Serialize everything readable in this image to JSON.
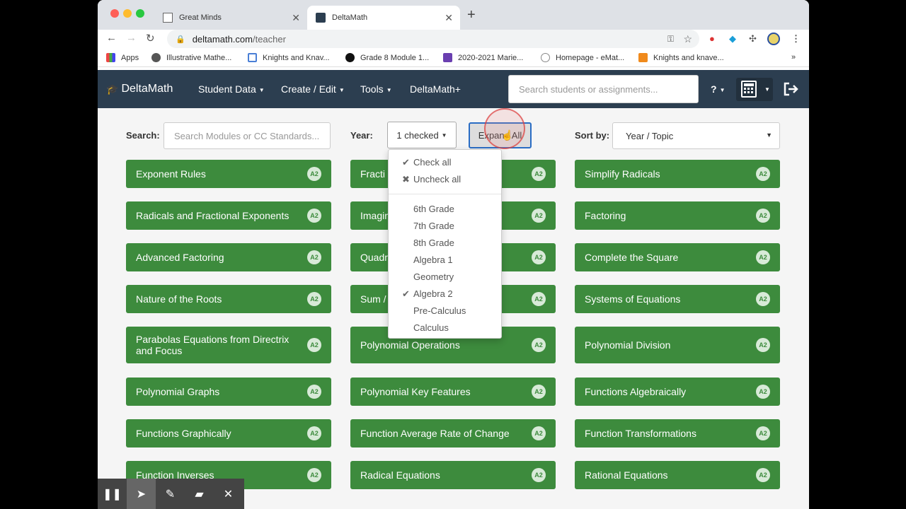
{
  "browser": {
    "tabs": [
      {
        "title": "Great Minds"
      },
      {
        "title": "DeltaMath"
      }
    ],
    "url_domain": "deltamath.com",
    "url_path": "/teacher",
    "bookmarks": [
      "Apps",
      "Illustrative Mathe...",
      "Knights and Knav...",
      "Grade 8 Module 1...",
      "2020-2021 Marie...",
      "Homepage - eMat...",
      "Knights and knave..."
    ],
    "bookmarks_more": "»"
  },
  "navbar": {
    "brand": "DeltaMath",
    "items": [
      "Student Data",
      "Create / Edit",
      "Tools",
      "DeltaMath+"
    ],
    "search_placeholder": "Search students or assignments...",
    "help": "?"
  },
  "filters": {
    "search_label": "Search:",
    "search_placeholder": "Search Modules or CC Standards...",
    "year_label": "Year:",
    "year_button": "1 checked",
    "expand_label": "Expand All",
    "sort_label": "Sort by:",
    "sort_value": "Year / Topic"
  },
  "year_menu": {
    "check_all": "Check all",
    "uncheck_all": "Uncheck all",
    "options": [
      {
        "label": "6th Grade",
        "checked": false
      },
      {
        "label": "7th Grade",
        "checked": false
      },
      {
        "label": "8th Grade",
        "checked": false
      },
      {
        "label": "Algebra 1",
        "checked": false
      },
      {
        "label": "Geometry",
        "checked": false
      },
      {
        "label": "Algebra 2",
        "checked": true
      },
      {
        "label": "Pre-Calculus",
        "checked": false
      },
      {
        "label": "Calculus",
        "checked": false
      }
    ]
  },
  "modules": [
    {
      "title": "Exponent Rules",
      "badge": "A2"
    },
    {
      "title": "Fracti",
      "badge": "A2"
    },
    {
      "title": "Simplify Radicals",
      "badge": "A2"
    },
    {
      "title": "Radicals and Fractional Exponents",
      "badge": "A2"
    },
    {
      "title": "Imagin",
      "badge": "A2"
    },
    {
      "title": "Factoring",
      "badge": "A2"
    },
    {
      "title": "Advanced Factoring",
      "badge": "A2"
    },
    {
      "title": "Quadr",
      "badge": "A2"
    },
    {
      "title": "Complete the Square",
      "badge": "A2"
    },
    {
      "title": "Nature of the Roots",
      "badge": "A2"
    },
    {
      "title": "Sum /",
      "badge": "A2"
    },
    {
      "title": "Systems of Equations",
      "badge": "A2"
    },
    {
      "title": "Parabolas Equations from Directrix and Focus",
      "badge": "A2"
    },
    {
      "title": "Polynomial Operations",
      "badge": "A2"
    },
    {
      "title": "Polynomial Division",
      "badge": "A2"
    },
    {
      "title": "Polynomial Graphs",
      "badge": "A2"
    },
    {
      "title": "Polynomial Key Features",
      "badge": "A2"
    },
    {
      "title": "Functions Algebraically",
      "badge": "A2"
    },
    {
      "title": "Functions Graphically",
      "badge": "A2"
    },
    {
      "title": "Function Average Rate of Change",
      "badge": "A2"
    },
    {
      "title": "Function Transformations",
      "badge": "A2"
    },
    {
      "title": "Function Inverses",
      "badge": "A2"
    },
    {
      "title": "Radical Equations",
      "badge": "A2"
    },
    {
      "title": "Rational Equations",
      "badge": "A2"
    }
  ],
  "colors": {
    "navbar": "#2c3e50",
    "card": "#3d8b3d",
    "focus": "#2a6dc4"
  }
}
